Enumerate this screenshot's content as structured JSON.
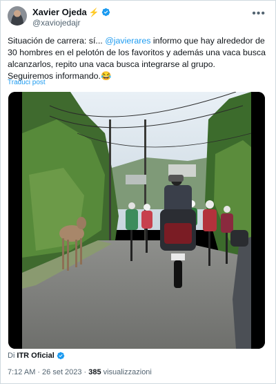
{
  "author": {
    "name": "Xavier Ojeda",
    "emoji": "⚡",
    "handle": "@xaviojedajr"
  },
  "tweet": {
    "text_before": "Situación de carrera: sí... ",
    "mention": "@javierares",
    "text_after": " informo que hay alrededor de 30 hombres en el pelotón de los favoritos y además una vaca  busca alcanzarlos, repito una vaca busca integrarse al grupo.",
    "last_line": "Seguiremos informando.😂",
    "translate_label": "Traduci post"
  },
  "media": {
    "description": "race-video-cow-chasing-cyclists"
  },
  "source": {
    "prefix": "Di",
    "name": "ITR Oficial"
  },
  "meta": {
    "time": "7:12 AM",
    "sep1": "·",
    "date": "26 set 2023",
    "sep2": "·",
    "views_count": "385",
    "views_label": "visualizzazioni"
  },
  "colors": {
    "link": "#1d9bf0",
    "verified": "#1d9bf0",
    "text": "#0f1419",
    "muted": "#536471"
  }
}
